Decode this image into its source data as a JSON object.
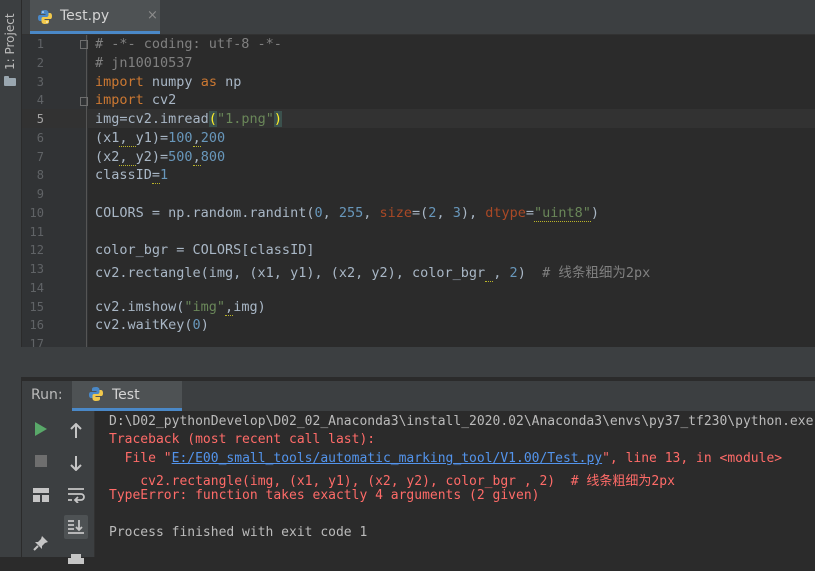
{
  "sidebar": {
    "project_tab": "1: Project"
  },
  "editor": {
    "tab": {
      "filename": "Test.py",
      "close": "×"
    },
    "lines": [
      {
        "no": "1"
      },
      {
        "no": "2"
      },
      {
        "no": "3"
      },
      {
        "no": "4"
      },
      {
        "no": "5"
      },
      {
        "no": "6"
      },
      {
        "no": "7"
      },
      {
        "no": "8"
      },
      {
        "no": "9"
      },
      {
        "no": "10"
      },
      {
        "no": "11"
      },
      {
        "no": "12"
      },
      {
        "no": "13"
      },
      {
        "no": "14"
      },
      {
        "no": "15"
      },
      {
        "no": "16"
      },
      {
        "no": "17"
      }
    ],
    "code": {
      "l1": "# -*- coding: utf-8 -*-",
      "l2": "# jn10010537",
      "l3_kw": "import",
      "l3_mod": " numpy ",
      "l3_as": "as",
      "l3_alias": " np",
      "l4_kw": "import",
      "l4_mod": " cv2",
      "l5_a": "img=cv2.imread",
      "l5_open": "(",
      "l5_str": "\"1.png\"",
      "l5_close": ")",
      "l6_a": "(x1",
      "l6_b": ", ",
      "l6_c": "y1)=",
      "l6_n1": "100",
      "l6_comma": ",",
      "l6_n2": "200",
      "l7_a": "(x2",
      "l7_b": ", ",
      "l7_c": "y2)=",
      "l7_n1": "500",
      "l7_comma": ",",
      "l7_n2": "800",
      "l8_a": "classID",
      "l8_eq": "=",
      "l8_n": "1",
      "l10_a": "COLORS = np.random.randint(",
      "l10_n1": "0",
      "l10_b": ", ",
      "l10_n2": "255",
      "l10_c": ", ",
      "l10_p1": "size",
      "l10_d": "=(",
      "l10_n3": "2",
      "l10_e": ", ",
      "l10_n4": "3",
      "l10_f": "), ",
      "l10_p2": "dtype",
      "l10_g": "=",
      "l10_s": "\"uint8\"",
      "l10_h": ")",
      "l12": "color_bgr = COLORS[classID]",
      "l13_a": "cv2.rectangle(img, (x1, y1), (x2, y2), color_bgr",
      "l13_sp": " ",
      "l13_b": ", ",
      "l13_n": "2",
      "l13_c": ")  ",
      "l13_cm": "# 线条粗细为2px",
      "l15_a": "cv2.imshow(",
      "l15_s": "\"img\"",
      "l15_comma": ",",
      "l15_b": "img)",
      "l16_a": "cv2.waitKey(",
      "l16_n": "0",
      "l16_b": ")"
    }
  },
  "run": {
    "label": "Run:",
    "tab": "Test",
    "toolbar": [
      "run-icon",
      "stop-icon",
      "up-arrow-icon",
      "down-arrow-icon",
      "layout-icon",
      "wrap-icon",
      "scroll-end-icon",
      "pin-icon"
    ],
    "output": {
      "cmd": "D:\\D02_pythonDevelop\\D02_02_Anaconda3\\install_2020.02\\Anaconda3\\envs\\py37_tf230\\python.exe",
      "tb": "Traceback (most recent call last):",
      "file_pre": "  File \"",
      "file_link": "E:/E00_small_tools/automatic_marking_tool/V1.00/Test.py",
      "file_post": "\", line 13, in <module>",
      "code_line": "    cv2.rectangle(img, (x1, y1), (x2, y2), color_bgr , 2)  # 线条粗细为2px",
      "error": "TypeError: function takes exactly 4 arguments (2 given)",
      "finished": "Process finished with exit code 1"
    }
  },
  "colors": {
    "background": "#2b2b2b",
    "panel": "#3c3f41",
    "keyword": "#cc7832",
    "string": "#6a8759",
    "number": "#6897bb",
    "comment": "#808080",
    "error": "#ff6b68",
    "link": "#5394ec",
    "run_green": "#59a869"
  }
}
